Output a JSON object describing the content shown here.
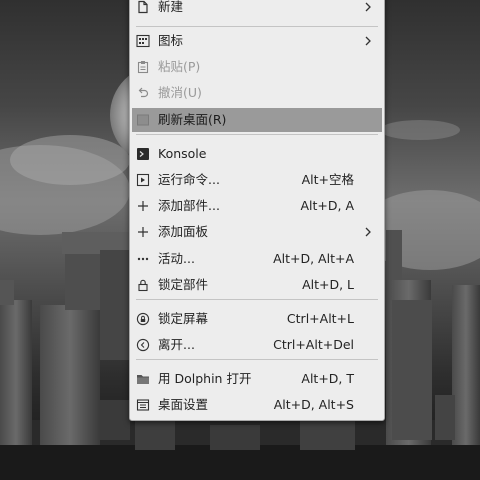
{
  "menu": {
    "items": [
      {
        "label": "新建",
        "shortcut": "",
        "icon": "new-document-icon",
        "submenu": true
      },
      {
        "label": "图标",
        "shortcut": "",
        "icon": "icons-view-icon",
        "submenu": true
      },
      {
        "label": "粘贴(P)",
        "shortcut": "",
        "icon": "clipboard-paste-icon",
        "disabled": true
      },
      {
        "label": "撤消(U)",
        "shortcut": "",
        "icon": "undo-icon",
        "disabled": true
      },
      {
        "label": "刷新桌面(R)",
        "shortcut": "",
        "icon": "refresh-icon",
        "highlighted": true
      },
      {
        "label": "Konsole",
        "shortcut": "",
        "icon": "terminal-icon"
      },
      {
        "label": "运行命令...",
        "shortcut": "Alt+空格",
        "icon": "run-command-icon"
      },
      {
        "label": "添加部件...",
        "shortcut": "Alt+D, A",
        "icon": "plus-icon"
      },
      {
        "label": "添加面板",
        "shortcut": "",
        "icon": "plus-icon",
        "submenu": true
      },
      {
        "label": "活动...",
        "shortcut": "Alt+D, Alt+A",
        "icon": "activities-icon"
      },
      {
        "label": "锁定部件",
        "shortcut": "Alt+D, L",
        "icon": "lock-icon"
      },
      {
        "label": "锁定屏幕",
        "shortcut": "Ctrl+Alt+L",
        "icon": "lock-screen-icon"
      },
      {
        "label": "离开...",
        "shortcut": "Ctrl+Alt+Del",
        "icon": "leave-icon"
      },
      {
        "label": "用 Dolphin 打开",
        "shortcut": "Alt+D, T",
        "icon": "folder-icon"
      },
      {
        "label": "桌面设置",
        "shortcut": "Alt+D, Alt+S",
        "icon": "desktop-settings-icon"
      }
    ]
  }
}
